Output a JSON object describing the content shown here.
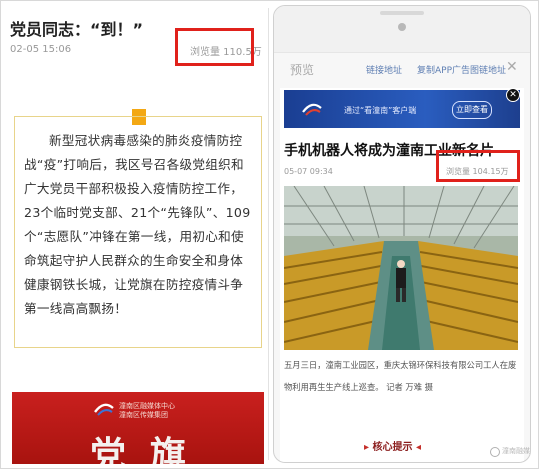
{
  "left": {
    "title": "党员同志：“到！”",
    "time": "02-05 15:06",
    "views": "浏览量 110.5万",
    "quote": "新型冠状病毒感染的肺炎疫情防控战“疫”打响后，我区号召各级党组织和广大党员干部积极投入疫情防控工作，23个临时党支部、21个“先锋队”、109个“志愿队”冲锋在第一线，用初心和使命筑起守护人民群众的生命安全和身体健康钢铁长城，让党旗在防控疫情斗争第一线高高飘扬！",
    "banner": {
      "line1": "潼南区融媒体中心",
      "line2": "潼南区传媒集团",
      "big": "党旗"
    }
  },
  "right": {
    "preview": "预览",
    "link1": "链接地址",
    "link2": "复制APP广告图链地址",
    "close": "✕",
    "ad": {
      "text": "通过“看潼南”客户端",
      "button": "立即查看",
      "close": "✕"
    },
    "article": {
      "title": "手机机器人将成为潼南工业新名片",
      "date": "05-07 09:34",
      "views": "浏览量 104.15万",
      "caption": "五月三日，潼南工业园区，重庆太锦环保科技有限公司工人在废物利用再生生产线上巡查。 记者 万难 摄"
    },
    "core": "核心提示"
  },
  "watermark": "潼南融媒"
}
